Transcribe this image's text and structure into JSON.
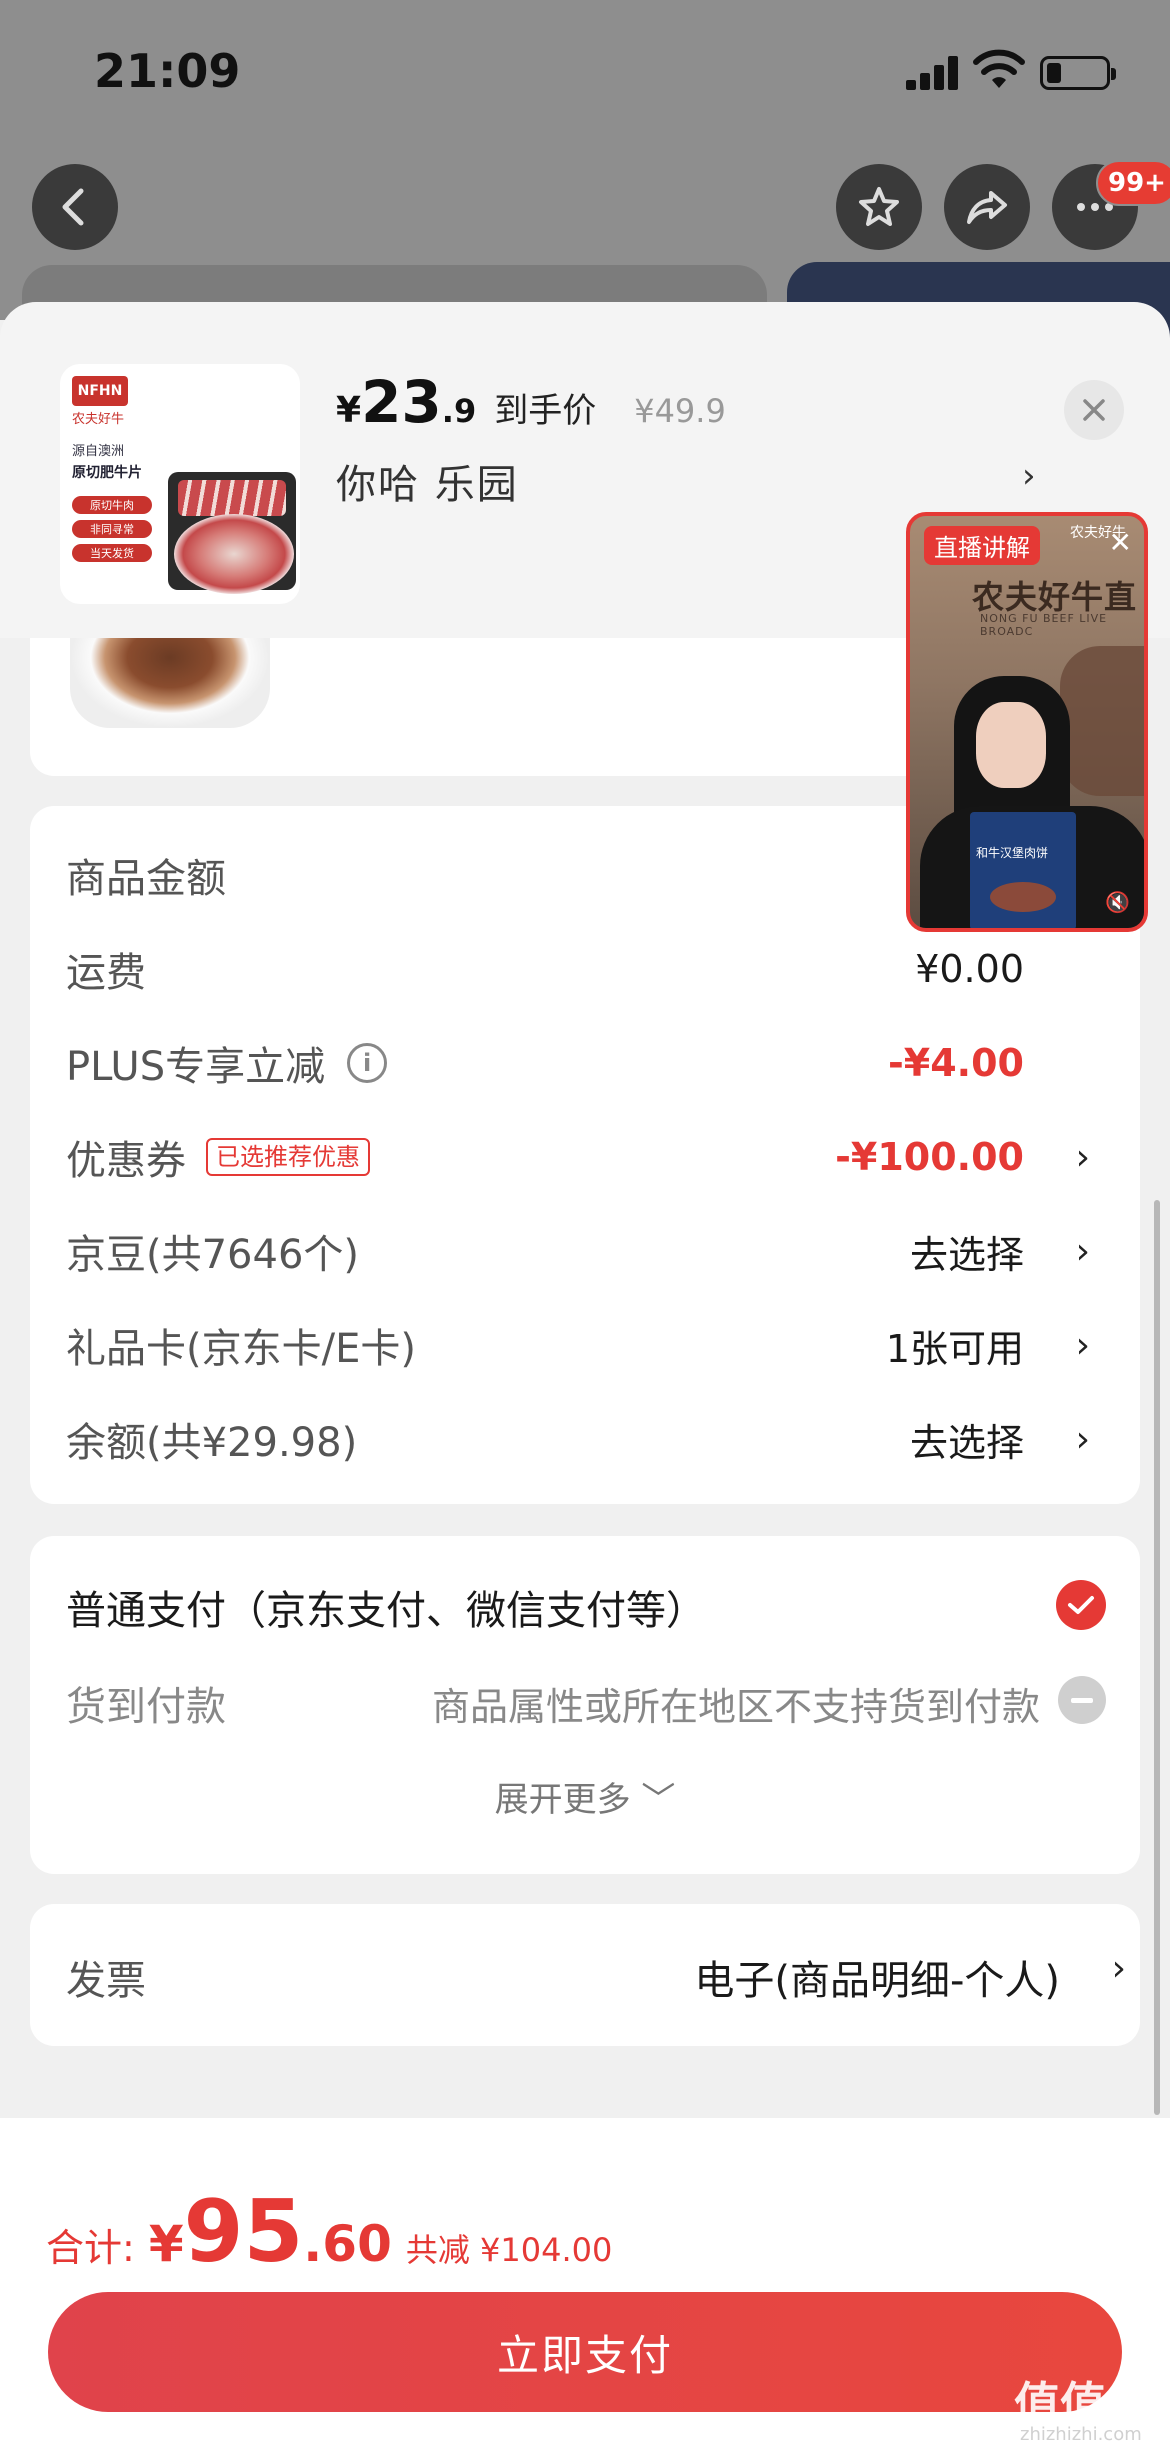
{
  "status_bar": {
    "time": "21:09"
  },
  "nav": {
    "more_badge": "99+"
  },
  "product": {
    "brand": "农夫好牛",
    "logo_text": "NFHN",
    "image_line1": "源自澳洲",
    "image_line2": "原切肥牛片",
    "image_tags": [
      "原切牛肉",
      "非同寻常",
      "当天发货"
    ],
    "price_yen": "¥",
    "price_int": "23",
    "price_dec": ".9",
    "price_tag": "到手价",
    "original_price": "¥49.9",
    "spec": "你哈  乐园",
    "arrow": "›"
  },
  "live": {
    "tag": "直播讲解",
    "brand": "农夫好牛",
    "bg_title": "农夫好牛直",
    "bg_sub": "NONG FU BEEF LIVE BROADC",
    "box_text": "和牛汉堡肉饼",
    "close": "✕",
    "mute": "🔇"
  },
  "summary": {
    "rows": [
      {
        "label": "商品金额",
        "value": ""
      },
      {
        "label": "运费",
        "value": "¥0.00"
      },
      {
        "label": "PLUS专享立减",
        "value": "-¥4.00"
      },
      {
        "label": "优惠券",
        "badge": "已选推荐优惠",
        "value": "-¥100.00"
      },
      {
        "label": "京豆(共7646个)",
        "value": "去选择"
      },
      {
        "label": "礼品卡(京东卡/E卡)",
        "value": "1张可用"
      },
      {
        "label": "余额(共¥29.98)",
        "value": "去选择"
      }
    ]
  },
  "payment": {
    "normal": "普通支付（京东支付、微信支付等）",
    "cod_label": "货到付款",
    "cod_note": "商品属性或所在地区不支持货到付款",
    "expand": "展开更多 ﹀"
  },
  "invoice": {
    "label": "发票",
    "value": "电子(商品明细-个人)"
  },
  "footer": {
    "total_label": "合计:",
    "total_yen": "¥",
    "total_int": "95",
    "total_dec": ".60",
    "saved": "共减 ¥104.00",
    "pay_button": "立即支付"
  },
  "watermark": {
    "text": "值值值",
    "url": "zhizhizhi.com"
  },
  "colors": {
    "accent": "#e53935",
    "button": "#e8473e",
    "overlay": "#8e8e8e"
  }
}
